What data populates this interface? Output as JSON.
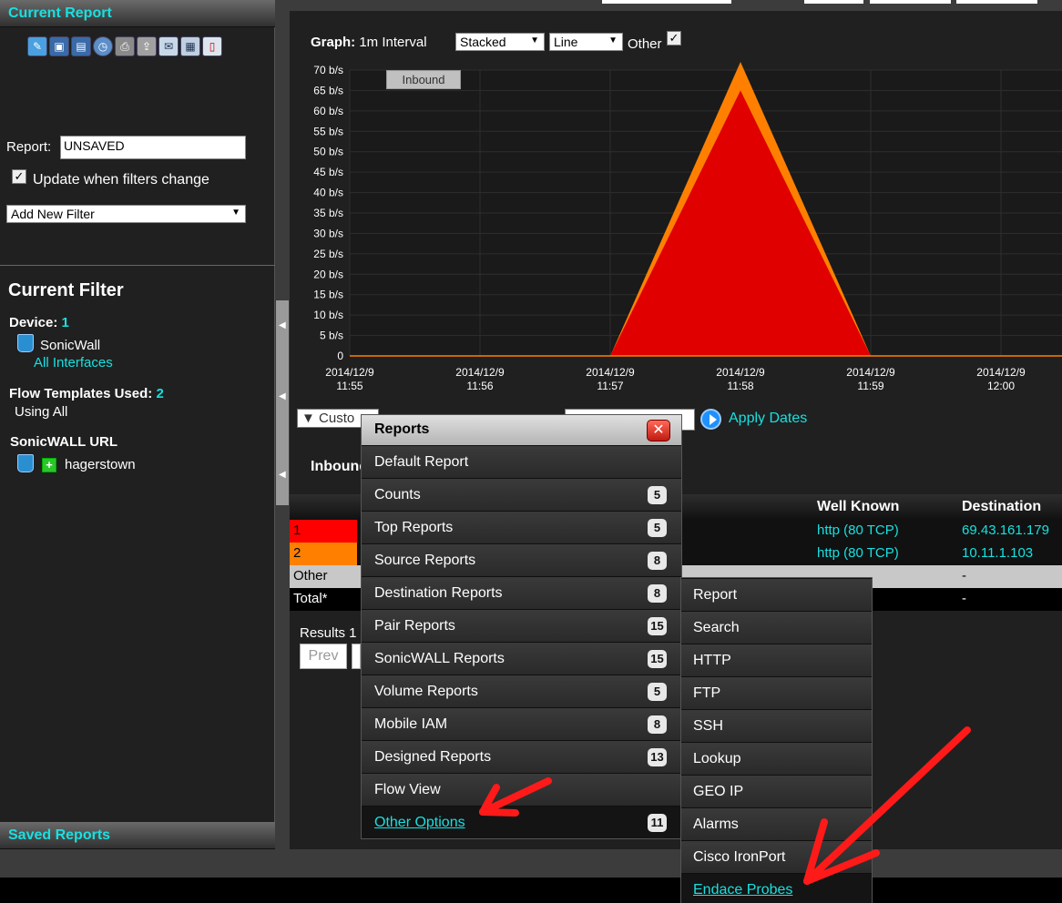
{
  "left_panel": {
    "current_report_title": "Current Report",
    "toolbar_icons": [
      "eraser-icon",
      "save-icon",
      "save-as-icon",
      "schedule-clock-icon",
      "print-icon",
      "export-icon",
      "email-icon",
      "csv-icon",
      "pdf-icon"
    ],
    "report_label": "Report:",
    "report_value": "UNSAVED",
    "update_label": "Update when filters change",
    "update_checked": "✓",
    "add_filter_value": "Add New Filter",
    "current_filter_title": "Current Filter",
    "device_label": "Device:",
    "device_count": "1",
    "device_name": "SonicWall",
    "interfaces_link": "All Interfaces",
    "templates_label": "Flow Templates Used:",
    "templates_count": "2",
    "templates_value": "Using All",
    "url_label": "SonicWALL URL",
    "url_value": "hagerstown",
    "saved_reports_title": "Saved Reports"
  },
  "graph_controls": {
    "graph_label": "Graph:",
    "interval": "1m Interval",
    "stack_value": "Stacked",
    "type_value": "Line",
    "other_label": "Other",
    "other_checked": "✓",
    "toggle_label": "Inbound"
  },
  "chart_data": {
    "type": "area",
    "x": [
      "2014/12/9 11:55",
      "2014/12/9 11:56",
      "2014/12/9 11:57",
      "2014/12/9 11:58",
      "2014/12/9 11:59",
      "2014/12/9 12:00"
    ],
    "x_ticks": [
      {
        "date": "2014/12/9",
        "time": "11:55"
      },
      {
        "date": "2014/12/9",
        "time": "11:56"
      },
      {
        "date": "2014/12/9",
        "time": "11:57"
      },
      {
        "date": "2014/12/9",
        "time": "11:58"
      },
      {
        "date": "2014/12/9",
        "time": "11:59"
      },
      {
        "date": "2014/12/9",
        "time": "12:00"
      }
    ],
    "y_ticks": [
      "0",
      "5 b/s",
      "10 b/s",
      "15 b/s",
      "20 b/s",
      "25 b/s",
      "30 b/s",
      "35 b/s",
      "40 b/s",
      "45 b/s",
      "50 b/s",
      "55 b/s",
      "60 b/s",
      "65 b/s",
      "70 b/s"
    ],
    "ylim": [
      0,
      70
    ],
    "series": [
      {
        "color": "#e00000",
        "values": [
          0,
          0,
          0,
          65,
          0,
          0
        ]
      },
      {
        "color": "#ff8000",
        "values": [
          0,
          0,
          0,
          7,
          0,
          0
        ]
      }
    ],
    "stacked": true,
    "grid": true
  },
  "date_controls": {
    "custom_label": "Custo",
    "apply_label": "Apply Dates"
  },
  "table": {
    "inbound_heading": "Inbound",
    "headers": {
      "well_known": "Well Known",
      "destination": "Destination"
    },
    "rows": [
      {
        "rank": "1",
        "color": "#ff0000",
        "well_known": "http (80 TCP)",
        "destination": "69.43.161.179"
      },
      {
        "rank": "2",
        "color": "#ff8000",
        "well_known": "http (80 TCP)",
        "destination": "10.11.1.103"
      }
    ],
    "other_label": "Other",
    "other_destination": "-",
    "total_label": "Total*",
    "total_destination": "-",
    "results_label": "Results 1",
    "prev_label": "Prev"
  },
  "reports_menu": {
    "title": "Reports",
    "close_label": "✕",
    "items": [
      {
        "label": "Default Report",
        "count": ""
      },
      {
        "label": "Counts",
        "count": "5"
      },
      {
        "label": "Top Reports",
        "count": "5"
      },
      {
        "label": "Source Reports",
        "count": "8"
      },
      {
        "label": "Destination Reports",
        "count": "8"
      },
      {
        "label": "Pair Reports",
        "count": "15"
      },
      {
        "label": "SonicWALL Reports",
        "count": "15"
      },
      {
        "label": "Volume Reports",
        "count": "5"
      },
      {
        "label": "Mobile IAM",
        "count": "8"
      },
      {
        "label": "Designed Reports",
        "count": "13"
      },
      {
        "label": "Flow View",
        "count": ""
      },
      {
        "label": "Other Options",
        "count": "11"
      }
    ],
    "submenu": [
      "Report",
      "Search",
      "HTTP",
      "FTP",
      "SSH",
      "Lookup",
      "GEO IP",
      "Alarms",
      "Cisco IronPort",
      "Endace Probes"
    ]
  },
  "colors": {
    "accent": "#18e0e0",
    "arrow": "#ff1a1a"
  }
}
